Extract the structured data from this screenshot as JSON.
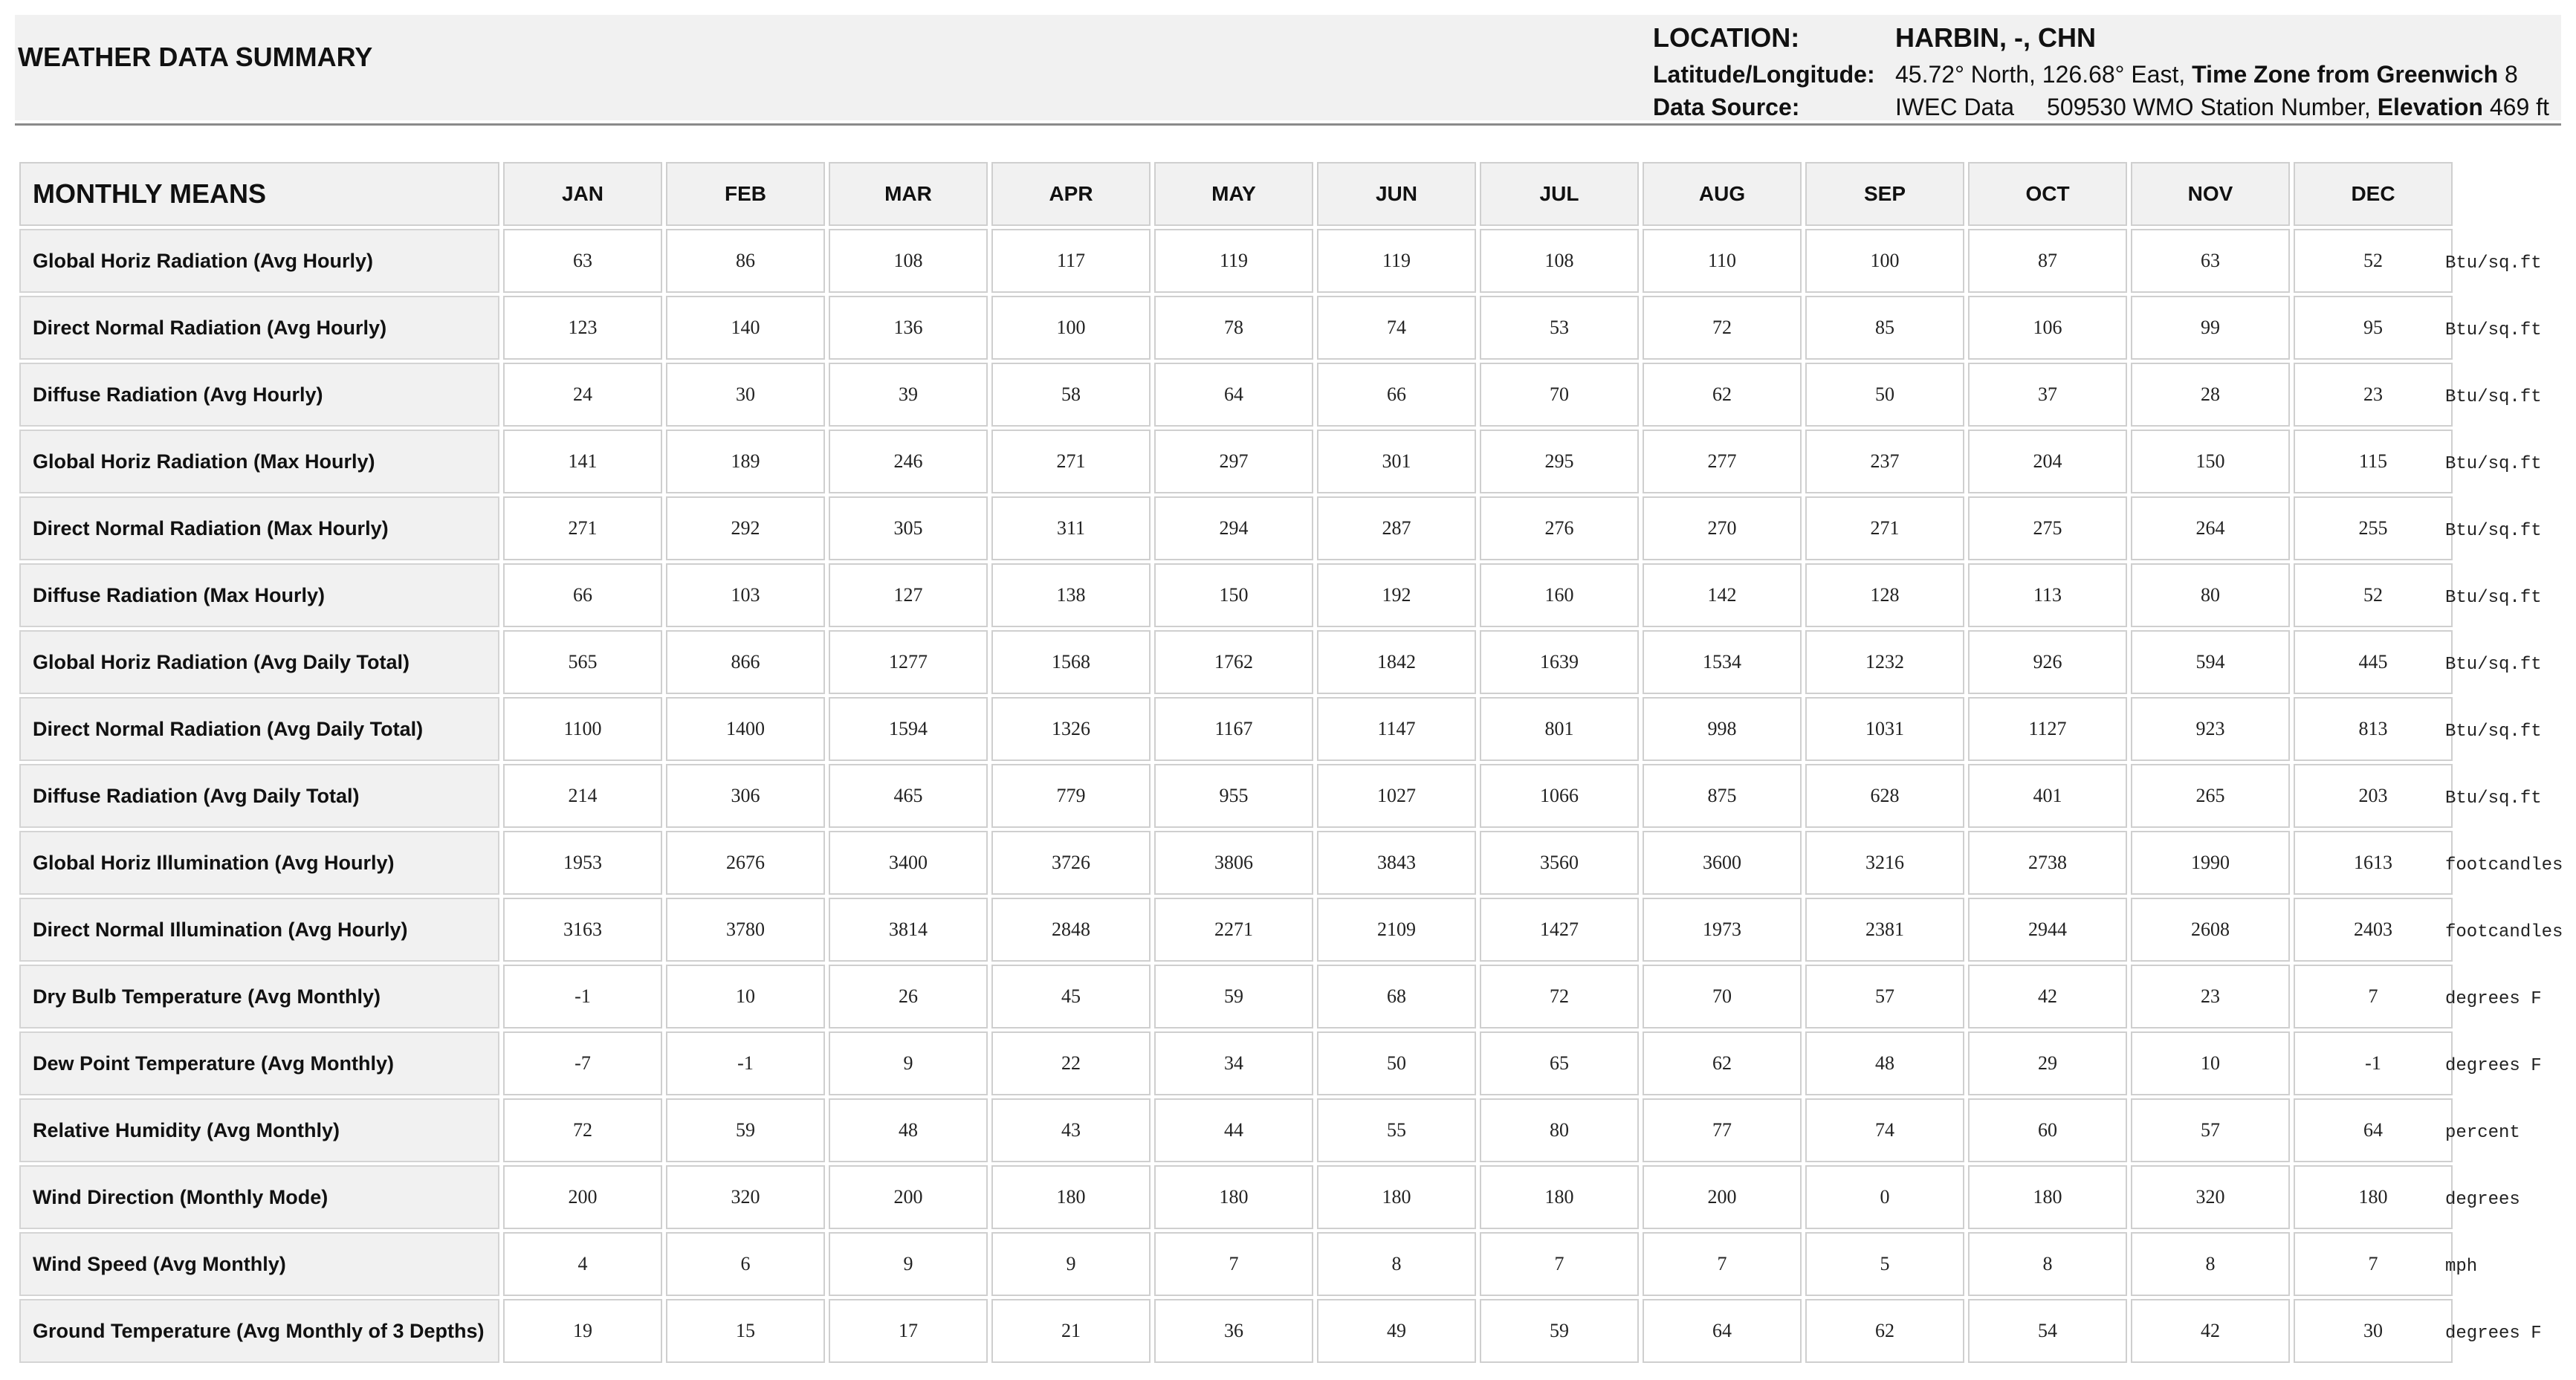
{
  "header": {
    "title": "WEATHER DATA SUMMARY",
    "location_label": "LOCATION:",
    "location_value": "HARBIN, -, CHN",
    "latlong_label": "Latitude/Longitude:",
    "latlong_coords": "45.72° North, 126.68° East,",
    "timezone_label": "Time Zone from Greenwich",
    "timezone_value": "8",
    "source_label": "Data Source:",
    "source_value": "IWEC Data",
    "station_value": "509530 WMO Station Number,",
    "elevation_label": "Elevation",
    "elevation_value": "469 ft"
  },
  "table": {
    "title": "MONTHLY MEANS",
    "months": [
      "JAN",
      "FEB",
      "MAR",
      "APR",
      "MAY",
      "JUN",
      "JUL",
      "AUG",
      "SEP",
      "OCT",
      "NOV",
      "DEC"
    ],
    "rows": [
      {
        "label": "Global Horiz Radiation (Avg Hourly)",
        "values": [
          "63",
          "86",
          "108",
          "117",
          "119",
          "119",
          "108",
          "110",
          "100",
          "87",
          "63",
          "52"
        ],
        "unit": "Btu/sq.ft"
      },
      {
        "label": "Direct Normal Radiation (Avg Hourly)",
        "values": [
          "123",
          "140",
          "136",
          "100",
          "78",
          "74",
          "53",
          "72",
          "85",
          "106",
          "99",
          "95"
        ],
        "unit": "Btu/sq.ft"
      },
      {
        "label": "Diffuse Radiation (Avg Hourly)",
        "values": [
          "24",
          "30",
          "39",
          "58",
          "64",
          "66",
          "70",
          "62",
          "50",
          "37",
          "28",
          "23"
        ],
        "unit": "Btu/sq.ft"
      },
      {
        "label": "Global Horiz Radiation (Max Hourly)",
        "values": [
          "141",
          "189",
          "246",
          "271",
          "297",
          "301",
          "295",
          "277",
          "237",
          "204",
          "150",
          "115"
        ],
        "unit": "Btu/sq.ft"
      },
      {
        "label": "Direct Normal Radiation (Max Hourly)",
        "values": [
          "271",
          "292",
          "305",
          "311",
          "294",
          "287",
          "276",
          "270",
          "271",
          "275",
          "264",
          "255"
        ],
        "unit": "Btu/sq.ft"
      },
      {
        "label": "Diffuse Radiation (Max Hourly)",
        "values": [
          "66",
          "103",
          "127",
          "138",
          "150",
          "192",
          "160",
          "142",
          "128",
          "113",
          "80",
          "52"
        ],
        "unit": "Btu/sq.ft"
      },
      {
        "label": "Global Horiz Radiation (Avg Daily Total)",
        "values": [
          "565",
          "866",
          "1277",
          "1568",
          "1762",
          "1842",
          "1639",
          "1534",
          "1232",
          "926",
          "594",
          "445"
        ],
        "unit": "Btu/sq.ft"
      },
      {
        "label": "Direct Normal Radiation (Avg Daily Total)",
        "values": [
          "1100",
          "1400",
          "1594",
          "1326",
          "1167",
          "1147",
          "801",
          "998",
          "1031",
          "1127",
          "923",
          "813"
        ],
        "unit": "Btu/sq.ft"
      },
      {
        "label": "Diffuse Radiation (Avg Daily Total)",
        "values": [
          "214",
          "306",
          "465",
          "779",
          "955",
          "1027",
          "1066",
          "875",
          "628",
          "401",
          "265",
          "203"
        ],
        "unit": "Btu/sq.ft"
      },
      {
        "label": "Global Horiz Illumination (Avg Hourly)",
        "values": [
          "1953",
          "2676",
          "3400",
          "3726",
          "3806",
          "3843",
          "3560",
          "3600",
          "3216",
          "2738",
          "1990",
          "1613"
        ],
        "unit": "footcandles"
      },
      {
        "label": "Direct Normal Illumination (Avg Hourly)",
        "values": [
          "3163",
          "3780",
          "3814",
          "2848",
          "2271",
          "2109",
          "1427",
          "1973",
          "2381",
          "2944",
          "2608",
          "2403"
        ],
        "unit": "footcandles"
      },
      {
        "label": "Dry Bulb Temperature (Avg Monthly)",
        "values": [
          "-1",
          "10",
          "26",
          "45",
          "59",
          "68",
          "72",
          "70",
          "57",
          "42",
          "23",
          "7"
        ],
        "unit": "degrees F"
      },
      {
        "label": "Dew Point Temperature (Avg Monthly)",
        "values": [
          "-7",
          "-1",
          "9",
          "22",
          "34",
          "50",
          "65",
          "62",
          "48",
          "29",
          "10",
          "-1"
        ],
        "unit": "degrees F"
      },
      {
        "label": "Relative Humidity (Avg Monthly)",
        "values": [
          "72",
          "59",
          "48",
          "43",
          "44",
          "55",
          "80",
          "77",
          "74",
          "60",
          "57",
          "64"
        ],
        "unit": "percent"
      },
      {
        "label": "Wind Direction (Monthly Mode)",
        "values": [
          "200",
          "320",
          "200",
          "180",
          "180",
          "180",
          "180",
          "200",
          "0",
          "180",
          "320",
          "180"
        ],
        "unit": "degrees"
      },
      {
        "label": "Wind Speed (Avg Monthly)",
        "values": [
          "4",
          "6",
          "9",
          "9",
          "7",
          "8",
          "7",
          "7",
          "5",
          "8",
          "8",
          "7"
        ],
        "unit": "mph"
      },
      {
        "label": "Ground Temperature (Avg Monthly of 3 Depths)",
        "values": [
          "19",
          "15",
          "17",
          "21",
          "36",
          "49",
          "59",
          "64",
          "62",
          "54",
          "42",
          "30"
        ],
        "unit": "degrees F"
      }
    ]
  }
}
